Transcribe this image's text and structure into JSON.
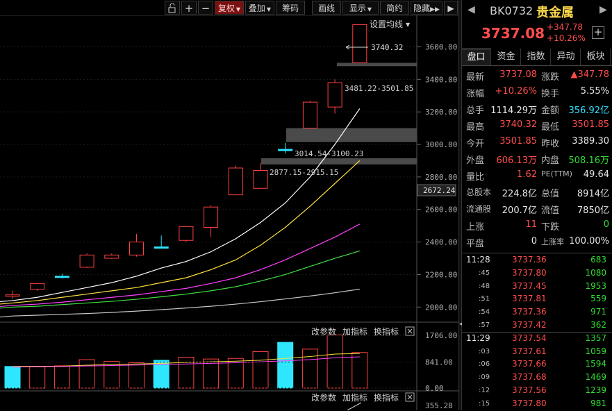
{
  "toolbar": {
    "buttons": [
      "复权",
      "叠加",
      "筹码",
      "画线",
      "显示",
      "简约",
      "隐藏"
    ]
  },
  "main_chart": {
    "settings_label": "设置均线",
    "high_marker": "3740.32",
    "gap_labels": [
      "3481.22-3501.85",
      "3014.54-3100.23",
      "2877.15-2915.15"
    ],
    "current_price_label": "2672.24",
    "y_ticks": [
      "3600.00",
      "3400.00",
      "3200.00",
      "3000.00",
      "2800.00",
      "2600.00",
      "2400.00",
      "2200.00",
      "2000.00"
    ]
  },
  "volume_chart": {
    "links": [
      "改参数",
      "加指标",
      "换指标"
    ],
    "y_ticks": [
      "1706.00",
      "841.00",
      "0.00"
    ]
  },
  "third_pane": {
    "links": [
      "改参数",
      "加指标",
      "换指标"
    ],
    "y_tick": "355.28"
  },
  "chart_data": {
    "type": "candlestick",
    "ylim": [
      1950,
      3760
    ],
    "candles": [
      {
        "o": 2070,
        "h": 2100,
        "l": 2050,
        "c": 2075
      },
      {
        "o": 2110,
        "h": 2150,
        "l": 2100,
        "c": 2145
      },
      {
        "o": 2190,
        "h": 2205,
        "l": 2175,
        "c": 2190
      },
      {
        "o": 2245,
        "h": 2330,
        "l": 2240,
        "c": 2320
      },
      {
        "o": 2300,
        "h": 2330,
        "l": 2295,
        "c": 2320
      },
      {
        "o": 2320,
        "h": 2450,
        "l": 2310,
        "c": 2400
      },
      {
        "o": 2370,
        "h": 2440,
        "l": 2365,
        "c": 2370
      },
      {
        "o": 2410,
        "h": 2500,
        "l": 2400,
        "c": 2495
      },
      {
        "o": 2490,
        "h": 2625,
        "l": 2430,
        "c": 2615
      },
      {
        "o": 2690,
        "h": 2870,
        "l": 2690,
        "c": 2855
      },
      {
        "o": 2730,
        "h": 2885,
        "l": 2730,
        "c": 2840
      },
      {
        "o": 2970,
        "h": 3010,
        "l": 2945,
        "c": 2970
      },
      {
        "o": 3100,
        "h": 3270,
        "l": 3100,
        "c": 3260
      },
      {
        "o": 3230,
        "h": 3400,
        "l": 3190,
        "c": 3380
      },
      {
        "o": 3501.85,
        "h": 3740.32,
        "l": 3501.85,
        "c": 3737.08
      }
    ],
    "ma_series": [
      {
        "color": "#ffffff",
        "values": [
          2040,
          2060,
          2090,
          2120,
          2150,
          2190,
          2240,
          2280,
          2340,
          2420,
          2520,
          2640,
          2800,
          3000,
          3220
        ]
      },
      {
        "color": "#ffe040",
        "values": [
          2025,
          2040,
          2060,
          2080,
          2100,
          2120,
          2150,
          2180,
          2230,
          2290,
          2380,
          2490,
          2620,
          2760,
          2900
        ]
      },
      {
        "color": "#ff40ff",
        "values": [
          2010,
          2018,
          2030,
          2045,
          2060,
          2075,
          2095,
          2115,
          2145,
          2180,
          2230,
          2290,
          2360,
          2430,
          2510
        ]
      },
      {
        "color": "#40e040",
        "values": [
          2000,
          2005,
          2015,
          2025,
          2035,
          2048,
          2063,
          2080,
          2100,
          2125,
          2160,
          2200,
          2250,
          2300,
          2345
        ]
      },
      {
        "color": "#c8c8c8",
        "values": [
          1945,
          1950,
          1955,
          1960,
          1967,
          1975,
          1984,
          1994,
          2005,
          2018,
          2033,
          2050,
          2068,
          2088,
          2110
        ]
      }
    ],
    "volume": {
      "ylim": [
        0,
        1706
      ],
      "values": [
        700,
        690,
        720,
        920,
        860,
        820,
        900,
        1000,
        940,
        960,
        1180,
        1480,
        1260,
        1720,
        1150
      ],
      "colors": [
        "cyan",
        "red",
        "red",
        "red",
        "red",
        "red",
        "cyan",
        "red",
        "red",
        "red",
        "red",
        "cyan",
        "red",
        "red",
        "red"
      ]
    }
  },
  "right_panel": {
    "code": "BK0732",
    "name": "贵金属",
    "price": "3737.08",
    "change": "+347.78",
    "change_pct": "+10.26%",
    "tabs": [
      "盘口",
      "资金",
      "指数",
      "异动",
      "板块"
    ],
    "quote_rows": [
      [
        "最新",
        "3737.08",
        "涨跌",
        "▲347.78"
      ],
      [
        "涨幅",
        "+10.26%",
        "换手",
        "5.55%"
      ],
      [
        "总手",
        "1114.29万",
        "金额",
        "356.92亿"
      ],
      [
        "最高",
        "3740.32",
        "最低",
        "3501.85"
      ],
      [
        "今开",
        "3501.85",
        "昨收",
        "3389.30"
      ],
      [
        "外盘",
        "606.13万",
        "内盘",
        "508.16万"
      ],
      [
        "量比",
        "1.62",
        "PE(TTM)",
        "49.64"
      ],
      [
        "总股本",
        "224.8亿",
        "总值",
        "8914亿"
      ],
      [
        "流通股",
        "200.7亿",
        "流值",
        "7850亿"
      ],
      [
        "上涨",
        "11",
        "下跌",
        "0"
      ],
      [
        "平盘",
        "0",
        "上涨率",
        "100.00%"
      ]
    ],
    "ticks": [
      [
        "11:28",
        "3737.36",
        "683"
      ],
      [
        ":45",
        "3737.80",
        "1080"
      ],
      [
        ":48",
        "3737.45",
        "1953"
      ],
      [
        ":51",
        "3737.81",
        "559"
      ],
      [
        ":54",
        "3737.36",
        "971"
      ],
      [
        ":57",
        "3737.42",
        "362"
      ],
      [
        "11:29",
        "3737.54",
        "1357"
      ],
      [
        ":03",
        "3737.61",
        "1059"
      ],
      [
        ":06",
        "3737.66",
        "1594"
      ],
      [
        ":09",
        "3737.68",
        "1469"
      ],
      [
        ":12",
        "3737.56",
        "1239"
      ],
      [
        ":15",
        "3737.80",
        "981"
      ]
    ]
  }
}
